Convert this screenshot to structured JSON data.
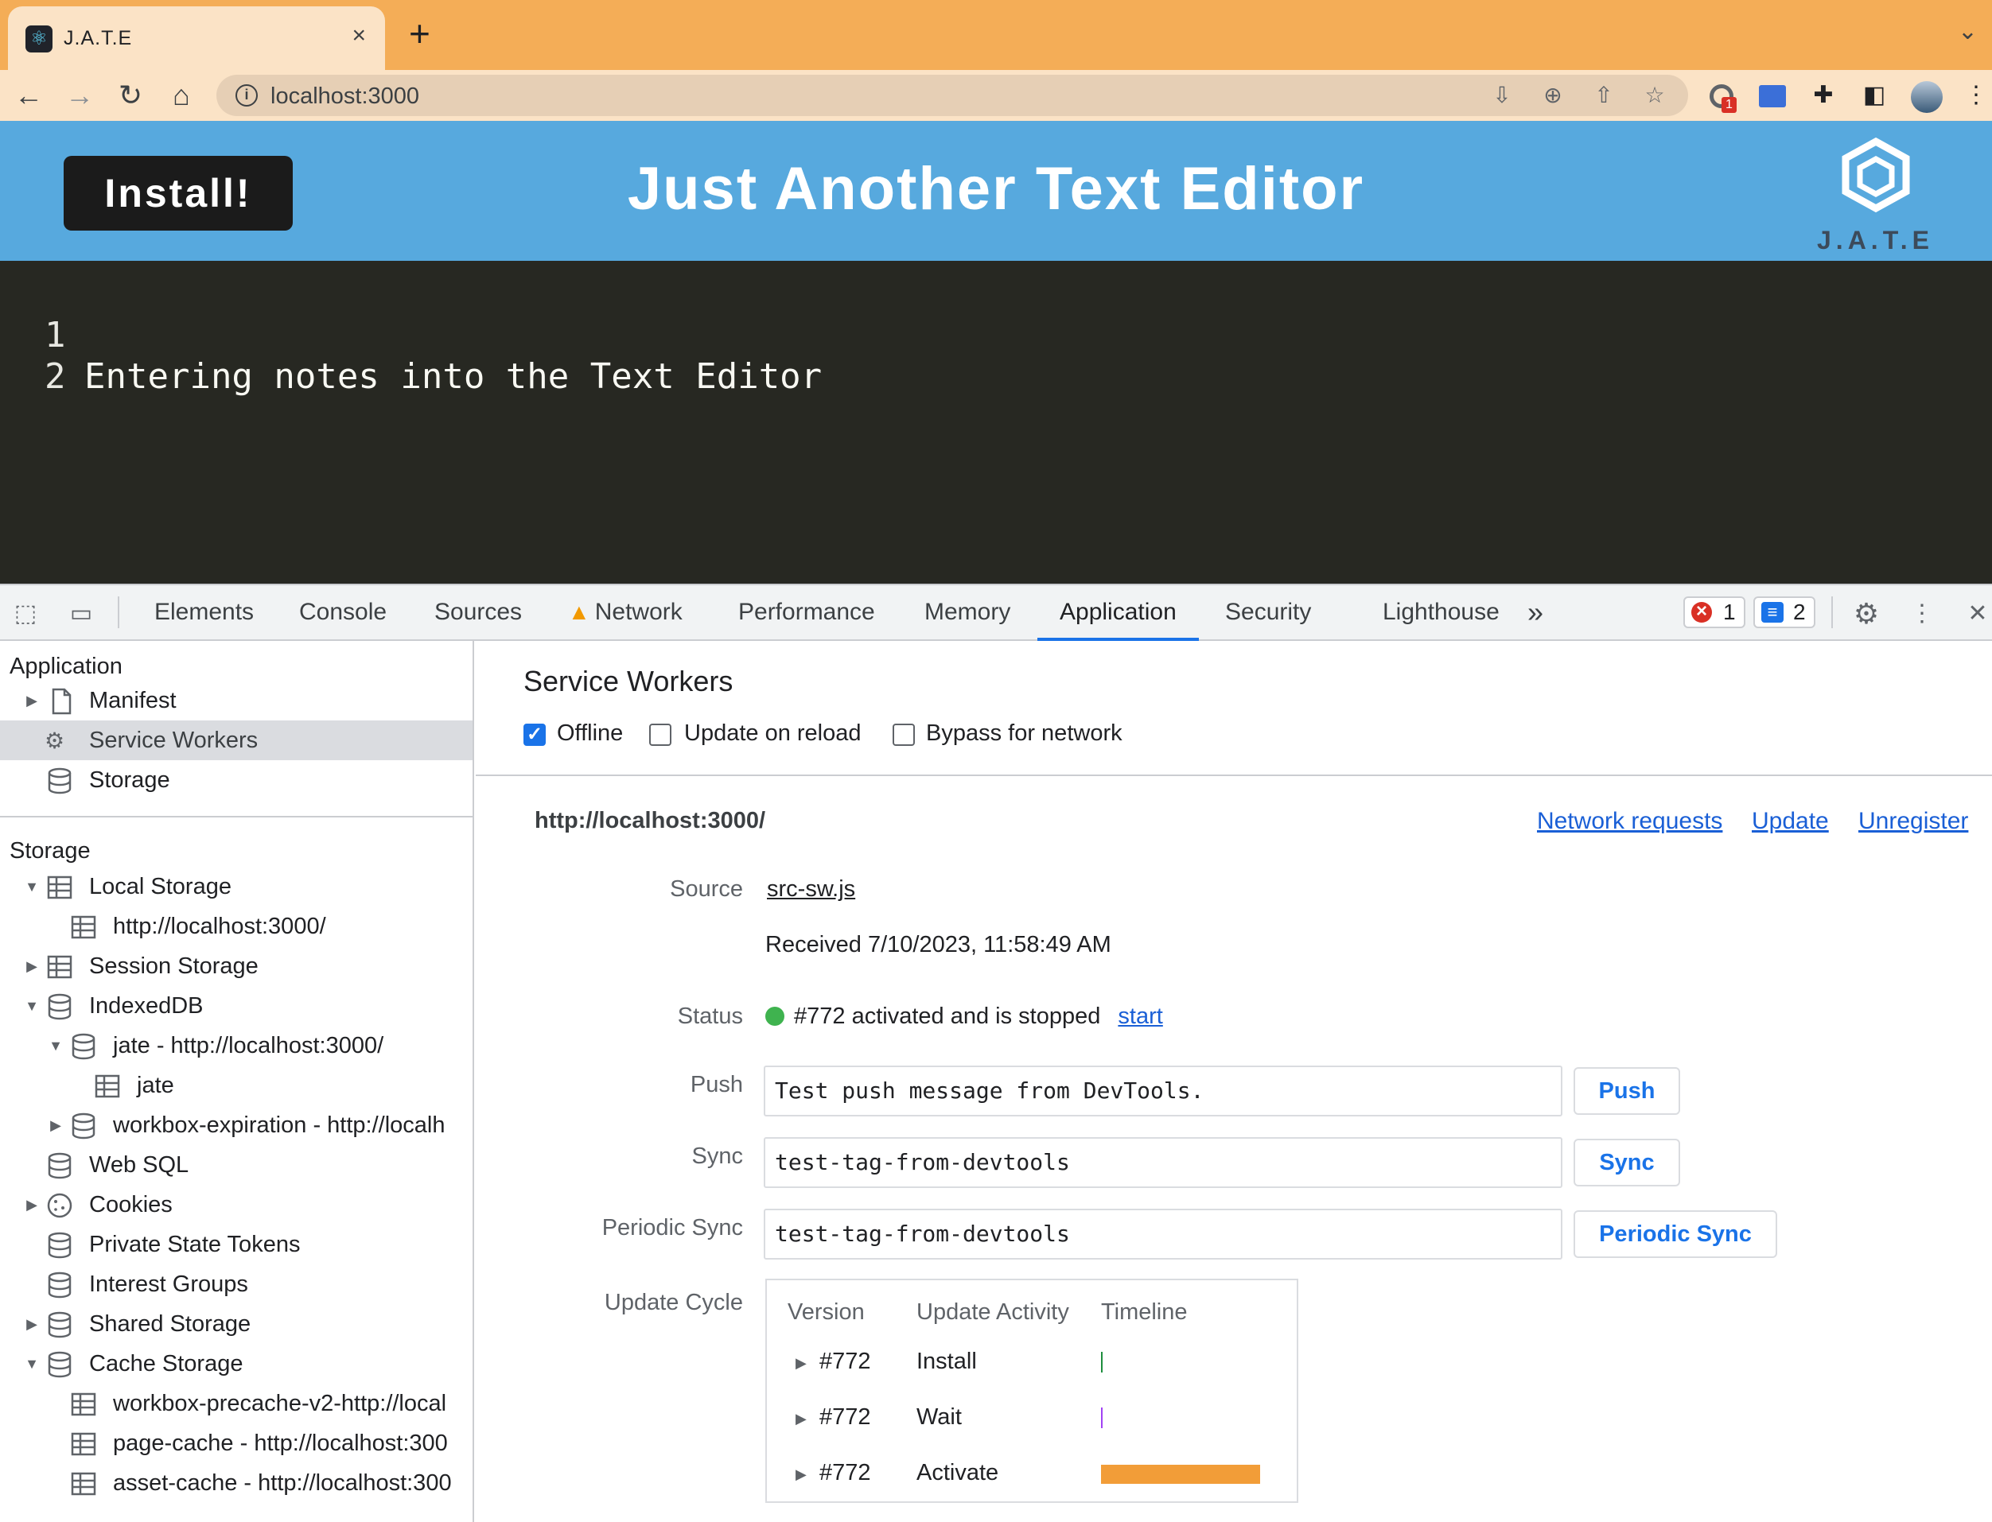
{
  "browser": {
    "tab_title": "J.A.T.E",
    "tab_close": "×",
    "new_tab": "+",
    "url": "localhost:3000",
    "extension_badge": "1"
  },
  "app": {
    "install_label": "Install!",
    "title": "Just Another Text Editor",
    "logo_text": "J.A.T.E",
    "editor_lines": [
      {
        "num": "1",
        "text": "Entering notes into the Text Editor"
      },
      {
        "num": "2",
        "text": ""
      }
    ]
  },
  "devtools": {
    "tabs": [
      "Elements",
      "Console",
      "Sources",
      "Network",
      "Performance",
      "Memory",
      "Application",
      "Security",
      "Lighthouse"
    ],
    "active_tab": "Application",
    "more_tabs": "»",
    "error_count": "1",
    "message_count": "2",
    "sidebar": {
      "application_heading": "Application",
      "application_items": [
        "Manifest",
        "Service Workers",
        "Storage"
      ],
      "storage_heading": "Storage",
      "storage_items": {
        "local_storage": "Local Storage",
        "local_storage_origin": "http://localhost:3000/",
        "session_storage": "Session Storage",
        "indexeddb": "IndexedDB",
        "jate_db": "jate - http://localhost:3000/",
        "jate_store": "jate",
        "workbox_expiration": "workbox-expiration - http://localh",
        "web_sql": "Web SQL",
        "cookies": "Cookies",
        "private_state_tokens": "Private State Tokens",
        "interest_groups": "Interest Groups",
        "shared_storage": "Shared Storage",
        "cache_storage": "Cache Storage",
        "precache": "workbox-precache-v2-http://local",
        "page_cache": "page-cache - http://localhost:300",
        "asset_cache": "asset-cache - http://localhost:300"
      }
    },
    "service_workers": {
      "title": "Service Workers",
      "offline_label": "Offline",
      "offline_checked": true,
      "update_on_reload_label": "Update on reload",
      "update_on_reload_checked": false,
      "bypass_label": "Bypass for network",
      "bypass_checked": false,
      "origin": "http://localhost:3000/",
      "links": {
        "network_requests": "Network requests",
        "update": "Update",
        "unregister": "Unregister"
      },
      "source_label": "Source",
      "source_file": "src-sw.js",
      "received": "Received 7/10/2023, 11:58:49 AM",
      "status_label": "Status",
      "status_text": "#772 activated and is stopped",
      "status_action": "start",
      "status_color": "#3fb34f",
      "push_label": "Push",
      "push_value": "Test push message from DevTools.",
      "push_button": "Push",
      "sync_label": "Sync",
      "sync_value": "test-tag-from-devtools",
      "sync_button": "Sync",
      "periodic_label": "Periodic Sync",
      "periodic_value": "test-tag-from-devtools",
      "periodic_button": "Periodic Sync",
      "update_cycle_label": "Update Cycle",
      "cycle_headers": {
        "version": "Version",
        "activity": "Update Activity",
        "timeline": "Timeline"
      },
      "cycle_rows": [
        {
          "version": "#772",
          "activity": "Install",
          "color": "#1e8e3e"
        },
        {
          "version": "#772",
          "activity": "Wait",
          "color": "#a142f4"
        },
        {
          "version": "#772",
          "activity": "Activate",
          "color": "#f29d38"
        }
      ]
    }
  }
}
